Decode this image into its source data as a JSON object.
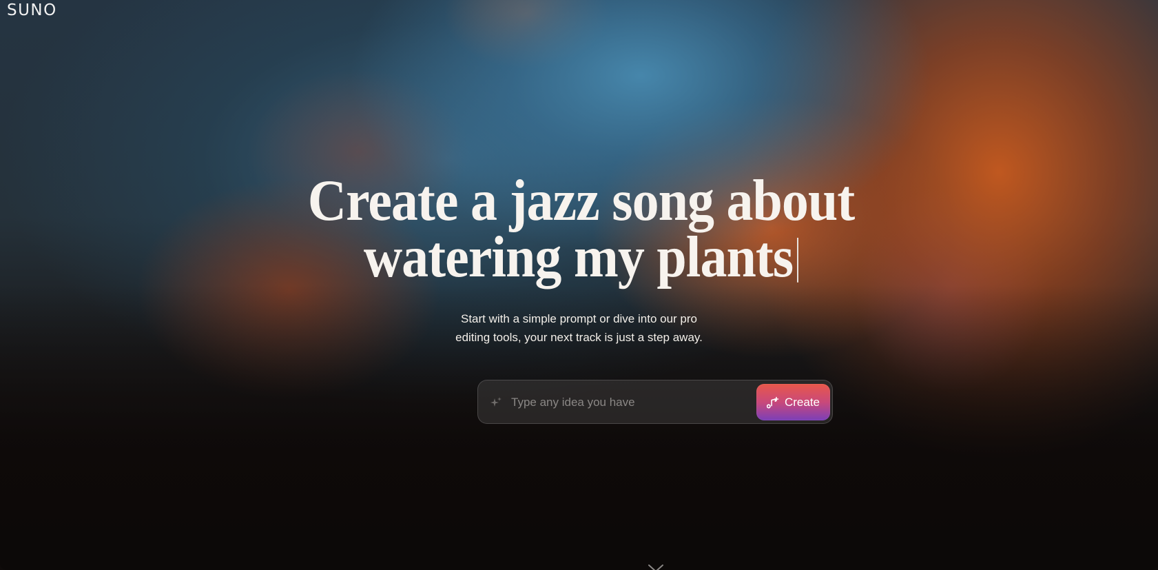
{
  "brand": {
    "logo_text": "SUNO"
  },
  "hero": {
    "headline_line1": "Create a jazz song about",
    "headline_line2": "watering my plants",
    "subtitle_line1": "Start with a simple prompt or dive into our pro",
    "subtitle_line2": "editing tools, your next track is just a step away."
  },
  "prompt": {
    "placeholder": "Type any idea you have",
    "value": "",
    "icon": "sparkle-icon",
    "create_label": "Create",
    "create_icon": "music-note-plus-icon"
  },
  "scroll": {
    "icon": "chevron-down-icon"
  },
  "colors": {
    "headline": "#f7f3ee",
    "button_gradient_top": "#e8584a",
    "button_gradient_bottom": "#7b3fb8",
    "background_dark": "#0d0a09",
    "background_blue": "#488ab0",
    "background_orange": "#c85a1e"
  }
}
